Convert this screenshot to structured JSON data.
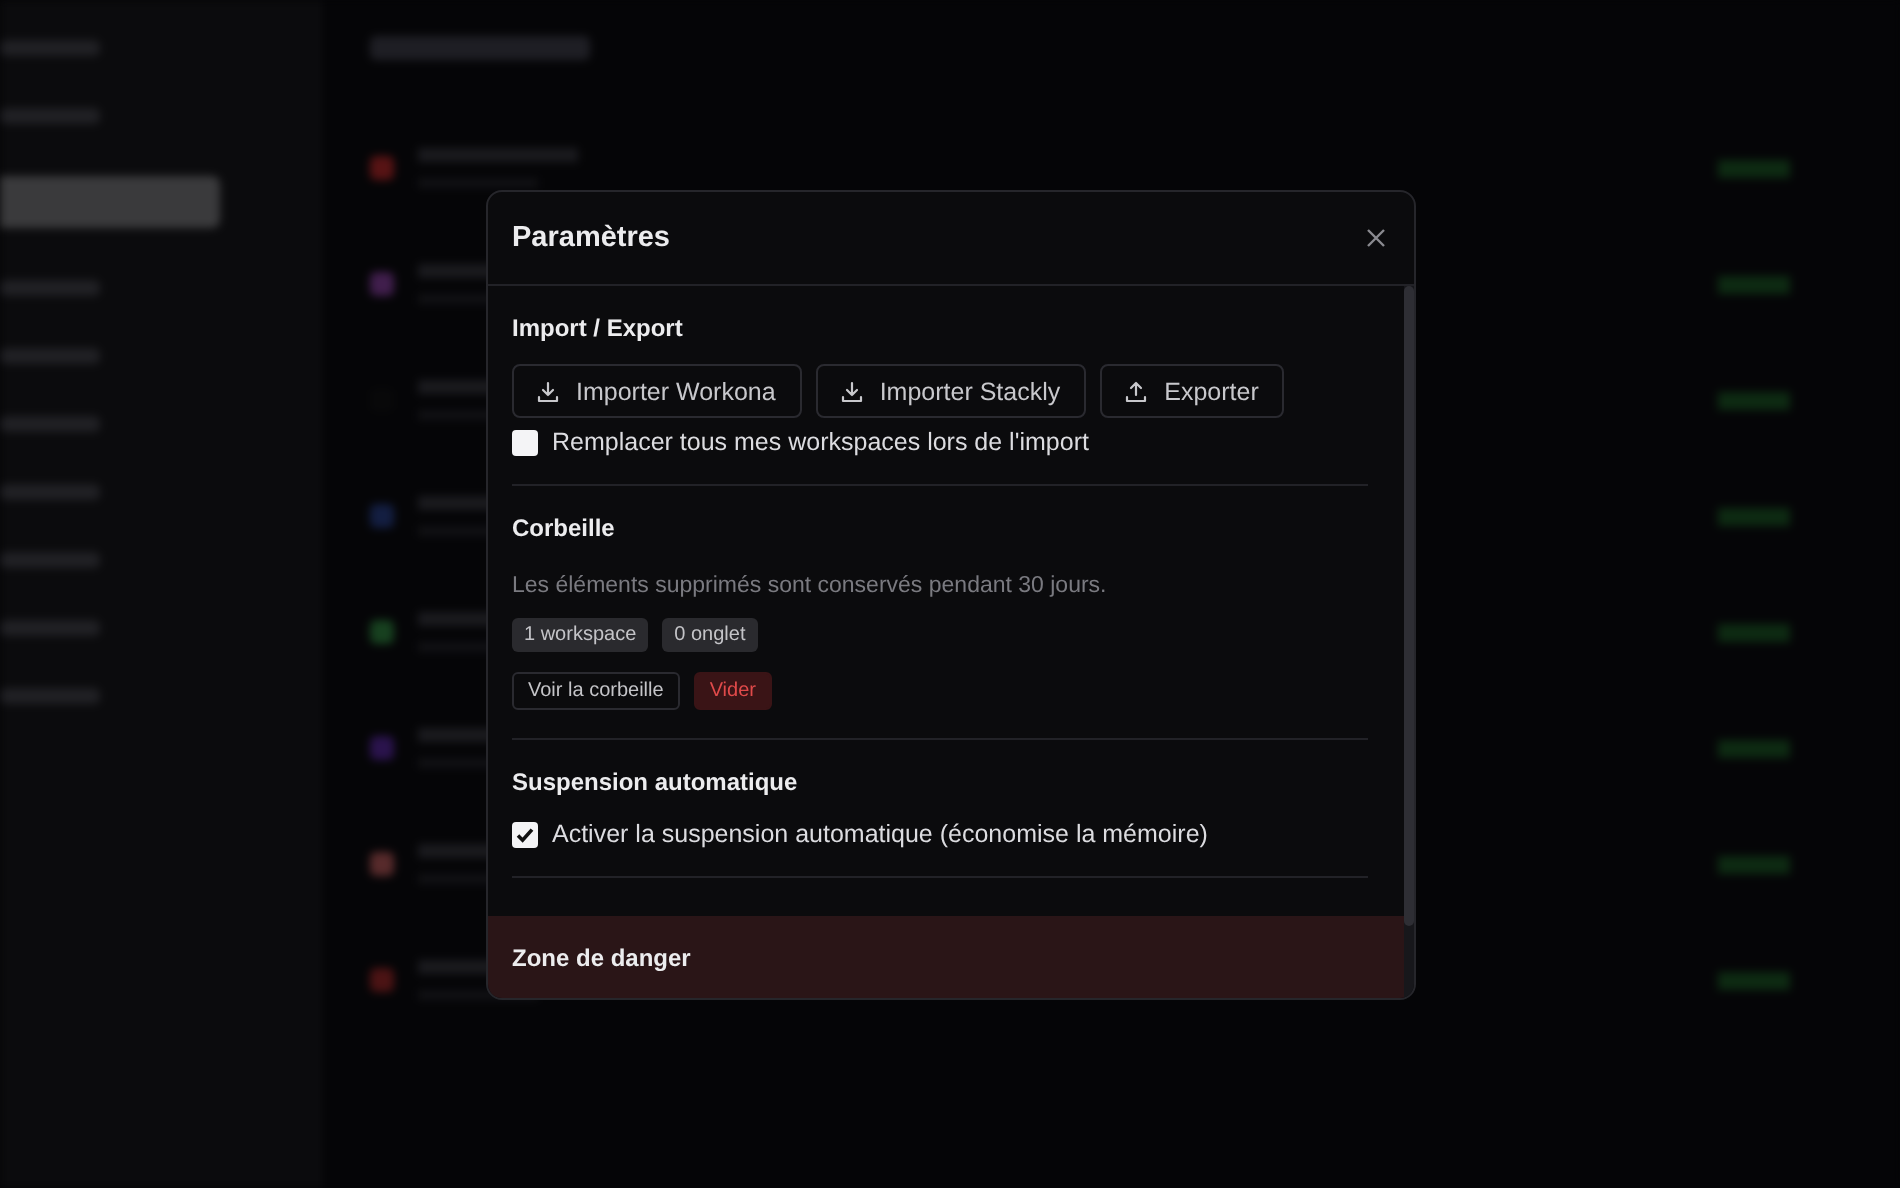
{
  "dialog": {
    "title": "Paramètres",
    "sections": [
      {
        "title": "Import / Export",
        "buttons": [
          {
            "label": "Importer Workona",
            "kind": "import"
          },
          {
            "label": "Importer Stackly",
            "kind": "import"
          },
          {
            "label": "Exporter",
            "kind": "export"
          }
        ],
        "checkbox": {
          "label": "Remplacer tous mes workspaces lors de l'import",
          "checked": false
        }
      },
      {
        "title": "Corbeille",
        "description": "Les éléments supprimés sont conservés pendant 30 jours.",
        "badges": [
          "1 workspace",
          "0 onglet"
        ],
        "small_buttons": [
          {
            "label": "Voir la corbeille",
            "kind": "view"
          },
          {
            "label": "Vider",
            "kind": "empty"
          }
        ]
      },
      {
        "title": "Suspension automatique",
        "checkbox": {
          "label": "Activer la suspension automatique (économise la mémoire)",
          "checked": true
        }
      }
    ],
    "danger_zone": {
      "title": "Zone de danger"
    }
  }
}
